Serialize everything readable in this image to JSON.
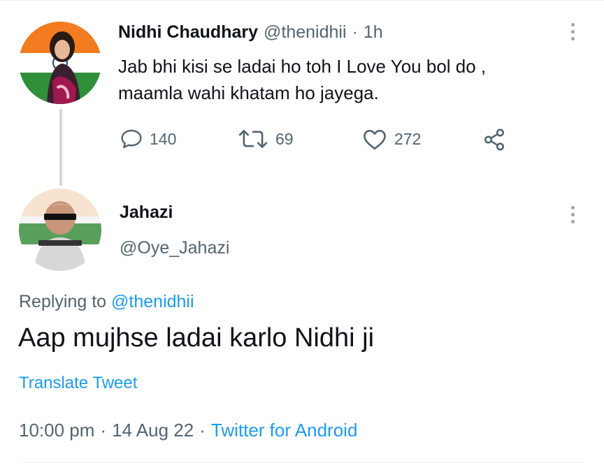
{
  "original_tweet": {
    "author_name": "Nidhi Chaudhary",
    "handle": "@thenidhii",
    "separator": "·",
    "time_ago": "1h",
    "text_line1": "Jab bhi kisi se ladai ho toh I Love You bol do ,",
    "text_line2": "maamla wahi khatam ho jayega.",
    "replies": "140",
    "retweets": "69",
    "likes": "272",
    "icons": [
      "reply-icon",
      "retweet-icon",
      "like-icon",
      "share-icon",
      "more-icon"
    ]
  },
  "reply_tweet": {
    "author_name": "Jahazi",
    "handle": "@Oye_Jahazi",
    "replying_prefix": "Replying to",
    "replying_handle": "@thenidhii",
    "text": "Aap mujhse ladai karlo Nidhi ji",
    "translate_label": "Translate Tweet",
    "time": "10:00 pm",
    "separator1": "·",
    "date": "14 Aug 22",
    "separator2": "·",
    "source": "Twitter for Android"
  },
  "colors": {
    "text": "#0f1419",
    "muted": "#536471",
    "link": "#1d9bf0",
    "line": "#cfd9de"
  }
}
